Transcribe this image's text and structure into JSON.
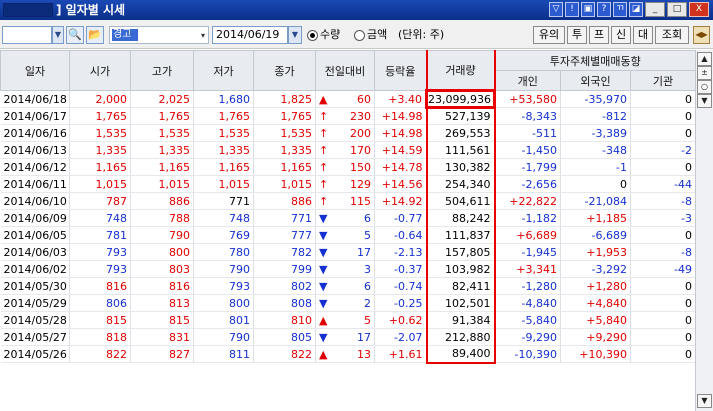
{
  "window": {
    "title": "] 일자별 시세",
    "title_buttons": [
      "▽",
      "!",
      "▣",
      "?",
      "ㄲ",
      "◪"
    ],
    "minimize": "_",
    "maximize": "□",
    "close": "X"
  },
  "toolbar": {
    "code_value": "",
    "code_drop": "▼",
    "search_icon": "🔍",
    "folder_icon": "📂",
    "name_highlight": "경고",
    "name_caret": "▾",
    "date_value": "2014/06/19",
    "date_drop": "▼",
    "radio_qty": "수량",
    "radio_amt": "금액",
    "unit": "(단위: 주)",
    "btn_yuui": "유의",
    "btn_tu": "투",
    "btn_peu": "프",
    "btn_sin": "신",
    "btn_dae": "대",
    "btn_johoe": "조회",
    "nav_icon": "◀▶"
  },
  "table": {
    "headers": {
      "date": "일자",
      "open": "시가",
      "high": "고가",
      "low": "저가",
      "close": "종가",
      "change": "전일대비",
      "rate": "등락율",
      "volume": "거래량",
      "investor": "투자주체별매매동향",
      "individual": "개인",
      "foreign": "외국인",
      "institution": "기관"
    },
    "rows": [
      {
        "date": "2014/06/18",
        "open": "2,000",
        "oc": "red",
        "high": "2,025",
        "hc": "red",
        "low": "1,680",
        "lc": "blue",
        "close": "1,825",
        "cc": "red",
        "arrow": "▲",
        "ac": "red",
        "change": "60",
        "rate": "+3.40",
        "rc": "red",
        "volume": "23,099,936",
        "ind": "+53,580",
        "ic": "red",
        "frn": "-35,970",
        "fc": "blue",
        "inst": "0",
        "nc": "blk"
      },
      {
        "date": "2014/06/17",
        "open": "1,765",
        "oc": "red",
        "high": "1,765",
        "hc": "red",
        "low": "1,765",
        "lc": "red",
        "close": "1,765",
        "cc": "red",
        "arrow": "↑",
        "ac": "red",
        "change": "230",
        "rate": "+14.98",
        "rc": "red",
        "volume": "527,139",
        "ind": "-8,343",
        "ic": "blue",
        "frn": "-812",
        "fc": "blue",
        "inst": "0",
        "nc": "blk"
      },
      {
        "date": "2014/06/16",
        "open": "1,535",
        "oc": "red",
        "high": "1,535",
        "hc": "red",
        "low": "1,535",
        "lc": "red",
        "close": "1,535",
        "cc": "red",
        "arrow": "↑",
        "ac": "red",
        "change": "200",
        "rate": "+14.98",
        "rc": "red",
        "volume": "269,553",
        "ind": "-511",
        "ic": "blue",
        "frn": "-3,389",
        "fc": "blue",
        "inst": "0",
        "nc": "blk"
      },
      {
        "date": "2014/06/13",
        "open": "1,335",
        "oc": "red",
        "high": "1,335",
        "hc": "red",
        "low": "1,335",
        "lc": "red",
        "close": "1,335",
        "cc": "red",
        "arrow": "↑",
        "ac": "red",
        "change": "170",
        "rate": "+14.59",
        "rc": "red",
        "volume": "111,561",
        "ind": "-1,450",
        "ic": "blue",
        "frn": "-348",
        "fc": "blue",
        "inst": "-2",
        "nc": "blue"
      },
      {
        "date": "2014/06/12",
        "open": "1,165",
        "oc": "red",
        "high": "1,165",
        "hc": "red",
        "low": "1,165",
        "lc": "red",
        "close": "1,165",
        "cc": "red",
        "arrow": "↑",
        "ac": "red",
        "change": "150",
        "rate": "+14.78",
        "rc": "red",
        "volume": "130,382",
        "ind": "-1,799",
        "ic": "blue",
        "frn": "-1",
        "fc": "blue",
        "inst": "0",
        "nc": "blk"
      },
      {
        "date": "2014/06/11",
        "open": "1,015",
        "oc": "red",
        "high": "1,015",
        "hc": "red",
        "low": "1,015",
        "lc": "red",
        "close": "1,015",
        "cc": "red",
        "arrow": "↑",
        "ac": "red",
        "change": "129",
        "rate": "+14.56",
        "rc": "red",
        "volume": "254,340",
        "ind": "-2,656",
        "ic": "blue",
        "frn": "0",
        "fc": "blk",
        "inst": "-44",
        "nc": "blue"
      },
      {
        "date": "2014/06/10",
        "open": "787",
        "oc": "red",
        "high": "886",
        "hc": "red",
        "low": "771",
        "lc": "blk",
        "close": "886",
        "cc": "red",
        "arrow": "↑",
        "ac": "red",
        "change": "115",
        "rate": "+14.92",
        "rc": "red",
        "volume": "504,611",
        "ind": "+22,822",
        "ic": "red",
        "frn": "-21,084",
        "fc": "blue",
        "inst": "-8",
        "nc": "blue"
      },
      {
        "date": "2014/06/09",
        "open": "748",
        "oc": "blue",
        "high": "788",
        "hc": "red",
        "low": "748",
        "lc": "blue",
        "close": "771",
        "cc": "blue",
        "arrow": "▼",
        "ac": "blue",
        "change": "6",
        "rate": "-0.77",
        "rc": "blue",
        "volume": "88,242",
        "ind": "-1,182",
        "ic": "blue",
        "frn": "+1,185",
        "fc": "red",
        "inst": "-3",
        "nc": "blue"
      },
      {
        "date": "2014/06/05",
        "open": "781",
        "oc": "blue",
        "high": "790",
        "hc": "red",
        "low": "769",
        "lc": "blue",
        "close": "777",
        "cc": "blue",
        "arrow": "▼",
        "ac": "blue",
        "change": "5",
        "rate": "-0.64",
        "rc": "blue",
        "volume": "111,837",
        "ind": "+6,689",
        "ic": "red",
        "frn": "-6,689",
        "fc": "blue",
        "inst": "0",
        "nc": "blk"
      },
      {
        "date": "2014/06/03",
        "open": "793",
        "oc": "blue",
        "high": "800",
        "hc": "red",
        "low": "780",
        "lc": "blue",
        "close": "782",
        "cc": "blue",
        "arrow": "▼",
        "ac": "blue",
        "change": "17",
        "rate": "-2.13",
        "rc": "blue",
        "volume": "157,805",
        "ind": "-1,945",
        "ic": "blue",
        "frn": "+1,953",
        "fc": "red",
        "inst": "-8",
        "nc": "blue"
      },
      {
        "date": "2014/06/02",
        "open": "793",
        "oc": "blue",
        "high": "803",
        "hc": "red",
        "low": "790",
        "lc": "blue",
        "close": "799",
        "cc": "blue",
        "arrow": "▼",
        "ac": "blue",
        "change": "3",
        "rate": "-0.37",
        "rc": "blue",
        "volume": "103,982",
        "ind": "+3,341",
        "ic": "red",
        "frn": "-3,292",
        "fc": "blue",
        "inst": "-49",
        "nc": "blue"
      },
      {
        "date": "2014/05/30",
        "open": "816",
        "oc": "red",
        "high": "816",
        "hc": "red",
        "low": "793",
        "lc": "blue",
        "close": "802",
        "cc": "blue",
        "arrow": "▼",
        "ac": "blue",
        "change": "6",
        "rate": "-0.74",
        "rc": "blue",
        "volume": "82,411",
        "ind": "-1,280",
        "ic": "blue",
        "frn": "+1,280",
        "fc": "red",
        "inst": "0",
        "nc": "blk"
      },
      {
        "date": "2014/05/29",
        "open": "806",
        "oc": "blue",
        "high": "813",
        "hc": "red",
        "low": "800",
        "lc": "blue",
        "close": "808",
        "cc": "blue",
        "arrow": "▼",
        "ac": "blue",
        "change": "2",
        "rate": "-0.25",
        "rc": "blue",
        "volume": "102,501",
        "ind": "-4,840",
        "ic": "blue",
        "frn": "+4,840",
        "fc": "red",
        "inst": "0",
        "nc": "blk"
      },
      {
        "date": "2014/05/28",
        "open": "815",
        "oc": "red",
        "high": "815",
        "hc": "red",
        "low": "801",
        "lc": "blue",
        "close": "810",
        "cc": "red",
        "arrow": "▲",
        "ac": "red",
        "change": "5",
        "rate": "+0.62",
        "rc": "red",
        "volume": "91,384",
        "ind": "-5,840",
        "ic": "blue",
        "frn": "+5,840",
        "fc": "red",
        "inst": "0",
        "nc": "blk"
      },
      {
        "date": "2014/05/27",
        "open": "818",
        "oc": "red",
        "high": "831",
        "hc": "red",
        "low": "790",
        "lc": "blue",
        "close": "805",
        "cc": "blue",
        "arrow": "▼",
        "ac": "blue",
        "change": "17",
        "rate": "-2.07",
        "rc": "blue",
        "volume": "212,880",
        "ind": "-9,290",
        "ic": "blue",
        "frn": "+9,290",
        "fc": "red",
        "inst": "0",
        "nc": "blk"
      },
      {
        "date": "2014/05/26",
        "open": "822",
        "oc": "red",
        "high": "827",
        "hc": "red",
        "low": "811",
        "lc": "blue",
        "close": "822",
        "cc": "red",
        "arrow": "▲",
        "ac": "red",
        "change": "13",
        "rate": "+1.61",
        "rc": "red",
        "volume": "89,400",
        "ind": "-10,390",
        "ic": "blue",
        "frn": "+10,390",
        "fc": "red",
        "inst": "0",
        "nc": "blk"
      }
    ]
  },
  "scrollbar": {
    "up": "▲",
    "expand": "±",
    "collapse": "○",
    "down": "▼",
    "bottom": "▼"
  },
  "colors": {
    "up": "#e00000",
    "down": "#1530d0",
    "highlight_border": "#e80000",
    "title_bar": "#1a49b5"
  }
}
